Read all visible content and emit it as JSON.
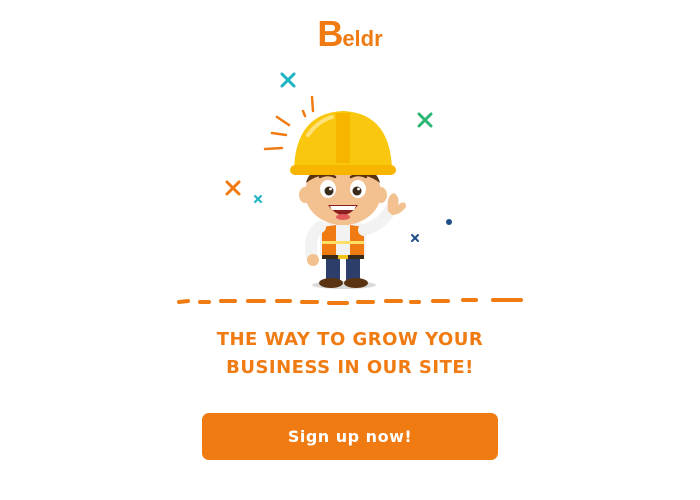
{
  "brand": {
    "initial": "B",
    "rest": "eldr",
    "color": "#f07b12"
  },
  "illustration": {
    "icon": "construction-worker-icon",
    "helmet_color": "#f9c80e",
    "accent_color": "#f07b12"
  },
  "headline": "THE WAY TO GROW YOUR BUSINESS IN OUR SITE!",
  "cta": {
    "label": "Sign up now!",
    "background": "#f07b12",
    "text_color": "#ffffff"
  }
}
